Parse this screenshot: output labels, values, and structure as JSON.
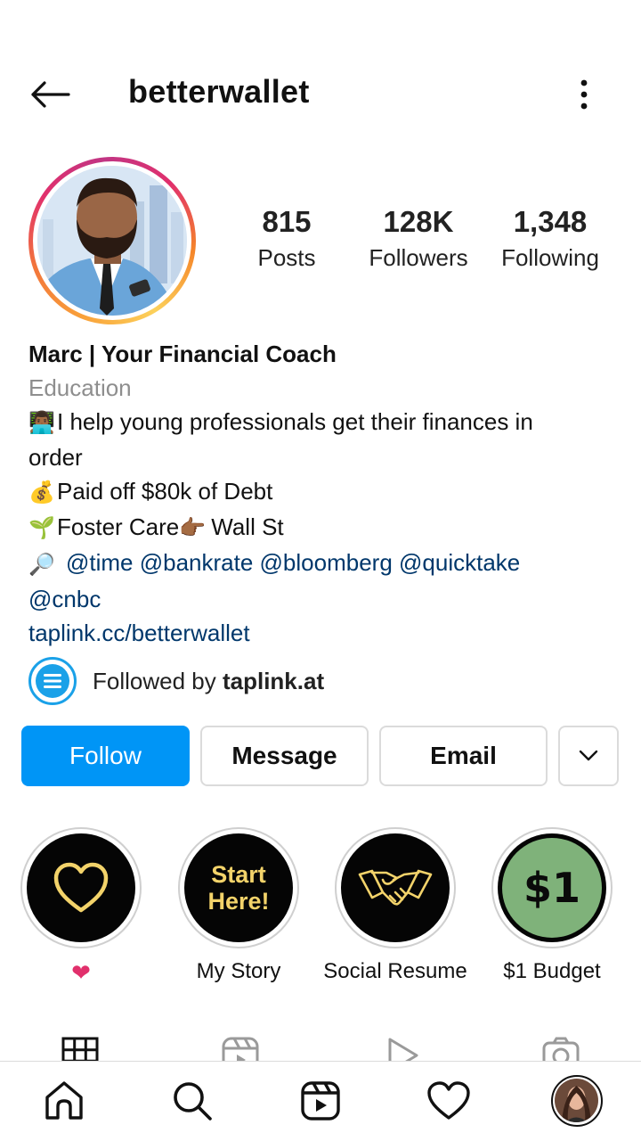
{
  "header": {
    "username": "betterwallet"
  },
  "stats": [
    {
      "value": "815",
      "label": "Posts"
    },
    {
      "value": "128K",
      "label": "Followers"
    },
    {
      "value": "1,348",
      "label": "Following"
    }
  ],
  "bio": {
    "name": "Marc | Your Financial Coach",
    "category": "Education",
    "lines": [
      {
        "emoji": "👨🏾‍💻",
        "text": "I help young professionals get their finances in"
      },
      {
        "emoji": "",
        "text": "order"
      },
      {
        "emoji": "💰",
        "text": "Paid off $80k of Debt"
      },
      {
        "emoji": "🌱",
        "text": "Foster Care",
        "emoji2": "👉🏾",
        "text2": "Wall St"
      }
    ],
    "mentions_emoji": "🔎",
    "mentions_line1": "@time @bankrate @bloomberg @quicktake",
    "mentions_line2": "@cnbc",
    "link": "taplink.cc/betterwallet"
  },
  "followed_by": {
    "prefix": "Followed by ",
    "account": "taplink.at"
  },
  "actions": {
    "follow": "Follow",
    "message": "Message",
    "email": "Email"
  },
  "highlights": [
    {
      "label": "❤",
      "icon": "heart-icon"
    },
    {
      "label": "My Story",
      "cover_line1": "Start",
      "cover_line2": "Here!"
    },
    {
      "label": "Social Resume",
      "icon": "handshake-icon"
    },
    {
      "label": "$1 Budget",
      "cover_text": "$1"
    }
  ],
  "colors": {
    "follow_button": "#0095f6",
    "link": "#00376b",
    "category": "#8e8e8e",
    "highlight_gold": "#f3d36a",
    "highlight_green": "#7fb27a"
  }
}
